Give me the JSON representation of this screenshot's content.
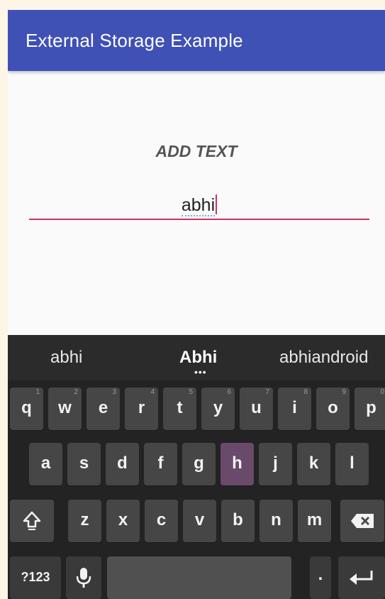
{
  "app_bar": {
    "title": "External Storage Example"
  },
  "main": {
    "label": "ADD TEXT",
    "input": {
      "value": "abhi"
    }
  },
  "keyboard": {
    "suggestions": [
      "abhi",
      "Abhi",
      "abhiandroid"
    ],
    "suggestion_more": "•••",
    "row1": [
      {
        "key": "q",
        "hint": "1"
      },
      {
        "key": "w",
        "hint": "2"
      },
      {
        "key": "e",
        "hint": "3"
      },
      {
        "key": "r",
        "hint": "4"
      },
      {
        "key": "t",
        "hint": "5"
      },
      {
        "key": "y",
        "hint": "6"
      },
      {
        "key": "u",
        "hint": "7"
      },
      {
        "key": "i",
        "hint": "8"
      },
      {
        "key": "o",
        "hint": "9"
      },
      {
        "key": "p",
        "hint": "0"
      }
    ],
    "row2": [
      "a",
      "s",
      "d",
      "f",
      "g",
      "h",
      "j",
      "k",
      "l"
    ],
    "row3": [
      "z",
      "x",
      "c",
      "v",
      "b",
      "n",
      "m"
    ],
    "symbols_label": "?123",
    "period_label": ".",
    "icons": {
      "shift": "shift-icon",
      "backspace": "backspace-icon",
      "mic": "microphone-icon",
      "enter": "enter-icon"
    }
  },
  "colors": {
    "app_bar": "#3f51b5",
    "accent": "#d0306a",
    "keyboard_bg": "#232323",
    "key_bg": "#464646"
  }
}
